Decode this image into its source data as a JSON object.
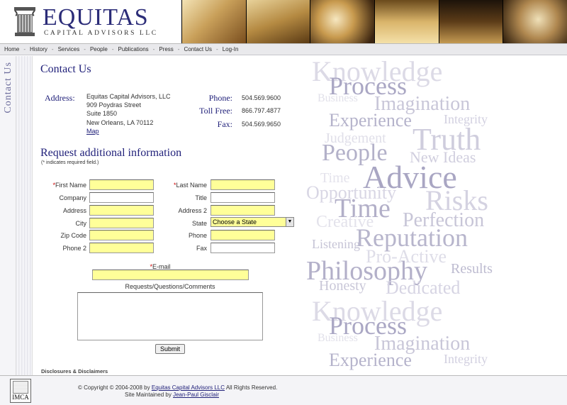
{
  "header": {
    "brand": "EQUITAS",
    "subtitle": "CAPITAL ADVISORS LLC"
  },
  "nav": {
    "items": [
      "Home",
      "History",
      "Services",
      "People",
      "Publications",
      "Press",
      "Contact Us",
      "Log-In"
    ]
  },
  "side_label": "Contact Us",
  "contact": {
    "title": "Contact Us",
    "address_label": "Address:",
    "address_lines": [
      "Equitas Capital Advisors, LLC",
      "909 Poydras Street",
      "Suite 1850",
      "New Orleans, LA 70112"
    ],
    "map_link": "Map",
    "phone_label": "Phone:",
    "phone": "504.569.9600",
    "tollfree_label": "Toll Free:",
    "tollfree": "866.797.4877",
    "fax_label": "Fax:",
    "fax": "504.569.9650"
  },
  "form": {
    "title": "Request additional information",
    "note": "(* indicates required field.)",
    "required_mark": "*",
    "labels": {
      "first_name": "First Name",
      "last_name": "Last Name",
      "company": "Company",
      "title": "Title",
      "address": "Address",
      "address2": "Address 2",
      "city": "City",
      "state": "State",
      "zip": "Zip Code",
      "phone": "Phone",
      "phone2": "Phone 2",
      "fax": "Fax",
      "email": "E-mail",
      "comments": "Requests/Questions/Comments"
    },
    "state_selected": "Choose a State",
    "submit_label": "Submit"
  },
  "disclosures": "Disclosures & Disclaimers",
  "word_cloud": [
    "Knowledge",
    "Process",
    "Business",
    "Imagination",
    "Experience",
    "Integrity",
    "Judgement",
    "Truth",
    "People",
    "New Ideas",
    "Time",
    "Advice",
    "Opportunity",
    "Risks",
    "Time",
    "Creative",
    "Perfection",
    "Reputation",
    "Listening",
    "Pro-Active",
    "Philosophy",
    "Results",
    "Honesty",
    "Dedicated",
    "Knowledge",
    "Process",
    "Business",
    "Imagination",
    "Experience",
    "Integrity"
  ],
  "footer": {
    "logo_text": "IMCA",
    "copyright_prefix": "© Copyright © 2004-2008 by",
    "copyright_link": "Equitas Capital Advisors LLC",
    "copyright_suffix": "All Rights Reserved.",
    "maintained_prefix": "Site Maintained by",
    "maintained_link": "Jean-Paul Gisclair"
  },
  "colors": {
    "brand_navy": "#21217a",
    "required_field": "#ffff99",
    "required_mark": "#cc0000"
  }
}
